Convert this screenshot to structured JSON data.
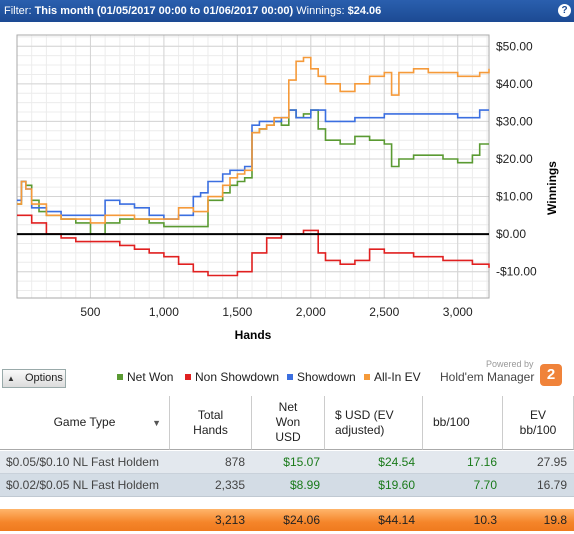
{
  "filter": {
    "label": "Filter:",
    "value": "This month (01/05/2017 00:00 to 01/06/2017 00:00)",
    "winnings_label": "Winnings:",
    "winnings_value": "$24.06",
    "help_icon": "?"
  },
  "chart_data": {
    "type": "line",
    "xlabel": "Hands",
    "ylabel": "Winnings",
    "xlim": [
      0,
      3213
    ],
    "ylim": [
      -17,
      53
    ],
    "x_ticks": [
      "500",
      "1,000",
      "1,500",
      "2,000",
      "2,500",
      "3,000"
    ],
    "x_tick_values": [
      500,
      1000,
      1500,
      2000,
      2500,
      3000
    ],
    "y_ticks": [
      "$50.00",
      "$40.00",
      "$30.00",
      "$20.00",
      "$10.00",
      "$0.00",
      "-$10.00"
    ],
    "y_tick_values": [
      50,
      40,
      30,
      20,
      10,
      0,
      -10
    ],
    "grid": true,
    "legend_position": "bottom",
    "series": [
      {
        "name": "Net Won",
        "color": "#5a9a32",
        "x": [
          0,
          30,
          60,
          100,
          150,
          200,
          300,
          400,
          500,
          600,
          700,
          800,
          900,
          1000,
          1100,
          1200,
          1300,
          1400,
          1450,
          1500,
          1550,
          1600,
          1650,
          1700,
          1750,
          1800,
          1850,
          1900,
          1950,
          2000,
          2050,
          2100,
          2200,
          2300,
          2400,
          2500,
          2550,
          2600,
          2700,
          2800,
          2900,
          3000,
          3100,
          3150,
          3213
        ],
        "y": [
          8,
          14,
          13,
          9,
          6,
          5,
          4,
          3,
          0,
          3,
          4,
          4,
          3,
          2,
          2,
          2,
          9,
          11,
          13,
          14,
          15,
          27,
          28,
          29,
          30,
          29,
          33,
          31,
          32,
          33,
          28,
          25,
          24,
          26,
          25,
          24,
          18,
          20,
          21,
          21,
          20,
          19,
          21,
          24,
          24
        ]
      },
      {
        "name": "Non Showdown",
        "color": "#e02020",
        "x": [
          0,
          50,
          100,
          200,
          300,
          400,
          500,
          600,
          700,
          800,
          900,
          1000,
          1100,
          1200,
          1300,
          1400,
          1500,
          1600,
          1700,
          1800,
          1900,
          1950,
          2000,
          2050,
          2100,
          2200,
          2300,
          2400,
          2500,
          2600,
          2700,
          2800,
          2900,
          3000,
          3100,
          3213
        ],
        "y": [
          5,
          5,
          3,
          0,
          -1,
          -2,
          -2,
          -2,
          -3,
          -4,
          -5,
          -6,
          -8,
          -10,
          -11,
          -11,
          -10,
          -5,
          -1,
          0,
          0,
          1,
          1,
          -5,
          -7,
          -8,
          -7,
          -4,
          -5,
          -5,
          -6,
          -6,
          -7,
          -7,
          -8,
          -9
        ]
      },
      {
        "name": "Showdown",
        "color": "#3b6fe0",
        "x": [
          0,
          30,
          60,
          100,
          200,
          300,
          400,
          500,
          600,
          700,
          800,
          900,
          1000,
          1100,
          1200,
          1250,
          1300,
          1400,
          1450,
          1500,
          1550,
          1600,
          1650,
          1700,
          1800,
          1850,
          1900,
          1950,
          2000,
          2100,
          2200,
          2300,
          2400,
          2500,
          2600,
          2700,
          2800,
          2900,
          3000,
          3100,
          3150,
          3213
        ],
        "y": [
          9,
          14,
          12,
          7,
          6,
          5,
          5,
          5,
          9,
          8,
          7,
          5,
          4,
          5,
          10,
          11,
          14,
          16,
          17,
          17,
          18,
          29,
          30,
          30,
          31,
          33,
          31,
          31,
          33,
          30,
          30,
          31,
          31,
          32,
          32,
          32,
          32,
          32,
          31,
          31,
          33,
          33
        ]
      },
      {
        "name": "All-In EV",
        "color": "#f59a3a",
        "x": [
          0,
          30,
          60,
          100,
          200,
          300,
          400,
          500,
          600,
          700,
          800,
          900,
          1000,
          1100,
          1200,
          1300,
          1400,
          1450,
          1500,
          1550,
          1600,
          1650,
          1700,
          1750,
          1800,
          1850,
          1900,
          1950,
          2000,
          2050,
          2100,
          2200,
          2300,
          2400,
          2500,
          2550,
          2600,
          2700,
          2800,
          2900,
          3000,
          3100,
          3150,
          3213
        ],
        "y": [
          8,
          14,
          12,
          8,
          5,
          4,
          4,
          3,
          5,
          5,
          4,
          4,
          4,
          7,
          6,
          10,
          13,
          15,
          16,
          17,
          27,
          28,
          29,
          31,
          31,
          41,
          46,
          47,
          44,
          42,
          40,
          38,
          40,
          42,
          43,
          37,
          43,
          44,
          43,
          43,
          42,
          42,
          43,
          44
        ]
      }
    ],
    "zero_line": 0
  },
  "legend": {
    "options_label": "Options",
    "items": [
      {
        "label": "Net Won",
        "color": "#5a9a32"
      },
      {
        "label": "Non Showdown",
        "color": "#e02020"
      },
      {
        "label": "Showdown",
        "color": "#3b6fe0"
      },
      {
        "label": "All-In EV",
        "color": "#f59a3a"
      }
    ],
    "powered_by": "Powered by",
    "brand": "Hold'em Manager",
    "brand_badge": "2"
  },
  "table": {
    "headers": {
      "game_type": "Game Type",
      "total_hands_1": "Total",
      "total_hands_2": "Hands",
      "net_won_1": "Net",
      "net_won_2": "Won",
      "net_won_3": "USD",
      "usd_ev_1": "$ USD (EV",
      "usd_ev_2": "adjusted)",
      "bb100": "bb/100",
      "ev_bb100_1": "EV",
      "ev_bb100_2": "bb/100"
    },
    "rows": [
      {
        "game_type": "$0.05/$0.10 NL Fast Holdem",
        "total_hands": "878",
        "net_won": "$15.07",
        "usd_ev": "$24.54",
        "bb100": "17.16",
        "ev_bb100": "27.95"
      },
      {
        "game_type": "$0.02/$0.05 NL Fast Holdem",
        "total_hands": "2,335",
        "net_won": "$8.99",
        "usd_ev": "$19.60",
        "bb100": "7.70",
        "ev_bb100": "16.79"
      }
    ],
    "totals": {
      "total_hands": "3,213",
      "net_won": "$24.06",
      "usd_ev": "$44.14",
      "bb100": "10.3",
      "ev_bb100": "19.8"
    }
  }
}
